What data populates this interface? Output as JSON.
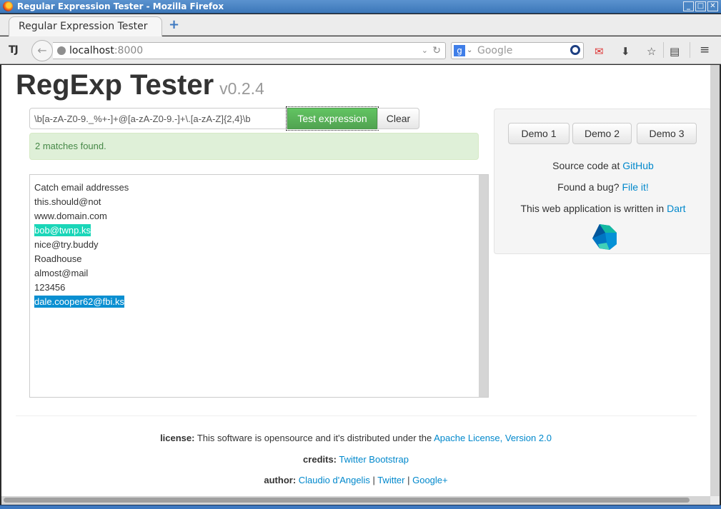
{
  "window": {
    "title": "Regular Expression Tester - Mozilla Firefox",
    "controls": {
      "minimize": "_",
      "maximize": "□",
      "close": "✕"
    }
  },
  "browser": {
    "tab_label": "Regular Expression Tester",
    "new_tab": "+",
    "url_host": "localhost",
    "url_port": ":8000",
    "search_placeholder": "Google",
    "toolbar_icons": [
      "pocket-icon",
      "download-icon",
      "bookmark-star-icon",
      "reading-list-icon",
      "menu-icon"
    ]
  },
  "page": {
    "title": "RegExp Tester",
    "version": "v0.2.4",
    "regex_value": "\\b[a-zA-Z0-9._%+-]+@[a-zA-Z0-9.-]+\\.[a-zA-Z]{2,4}\\b",
    "test_button": "Test expression",
    "clear_button": "Clear",
    "status": "2 matches found.",
    "text_lines": [
      {
        "text": "Catch email addresses",
        "match": false
      },
      {
        "text": "this.should@not",
        "match": false
      },
      {
        "text": "www.domain.com",
        "match": false
      },
      {
        "text": "bob@twnp.ks",
        "match": true,
        "color": "#1ad6b8"
      },
      {
        "text": "nice@try.buddy",
        "match": false
      },
      {
        "text": "Roadhouse",
        "match": false
      },
      {
        "text": "almost@mail",
        "match": false
      },
      {
        "text": "123456",
        "match": false
      },
      {
        "text": "dale.cooper62@fbi.ks",
        "match": true,
        "color": "#0a8fd1"
      }
    ]
  },
  "sidebar": {
    "demo_buttons": [
      "Demo 1",
      "Demo 2",
      "Demo 3"
    ],
    "source_prefix": "Source code at ",
    "source_link": "GitHub",
    "bug_prefix": "Found a bug? ",
    "bug_link": "File it!",
    "dart_prefix": "This web application is written in ",
    "dart_link": "Dart"
  },
  "footer": {
    "license_label": "license:",
    "license_text": " This software is opensource and it's distributed under the ",
    "license_link": "Apache License, Version 2.0",
    "credits_label": "credits:",
    "credits_link": "Twitter Bootstrap",
    "author_label": "author:",
    "author_link": "Claudio d'Angelis",
    "sep": " | ",
    "twitter_link": "Twitter",
    "googleplus_link": "Google+"
  },
  "colors": {
    "accent_link": "#0088cc",
    "success_bg": "#dff0d8",
    "success_text": "#468847",
    "match_1": "#1ad6b8",
    "match_2": "#0a8fd1"
  }
}
